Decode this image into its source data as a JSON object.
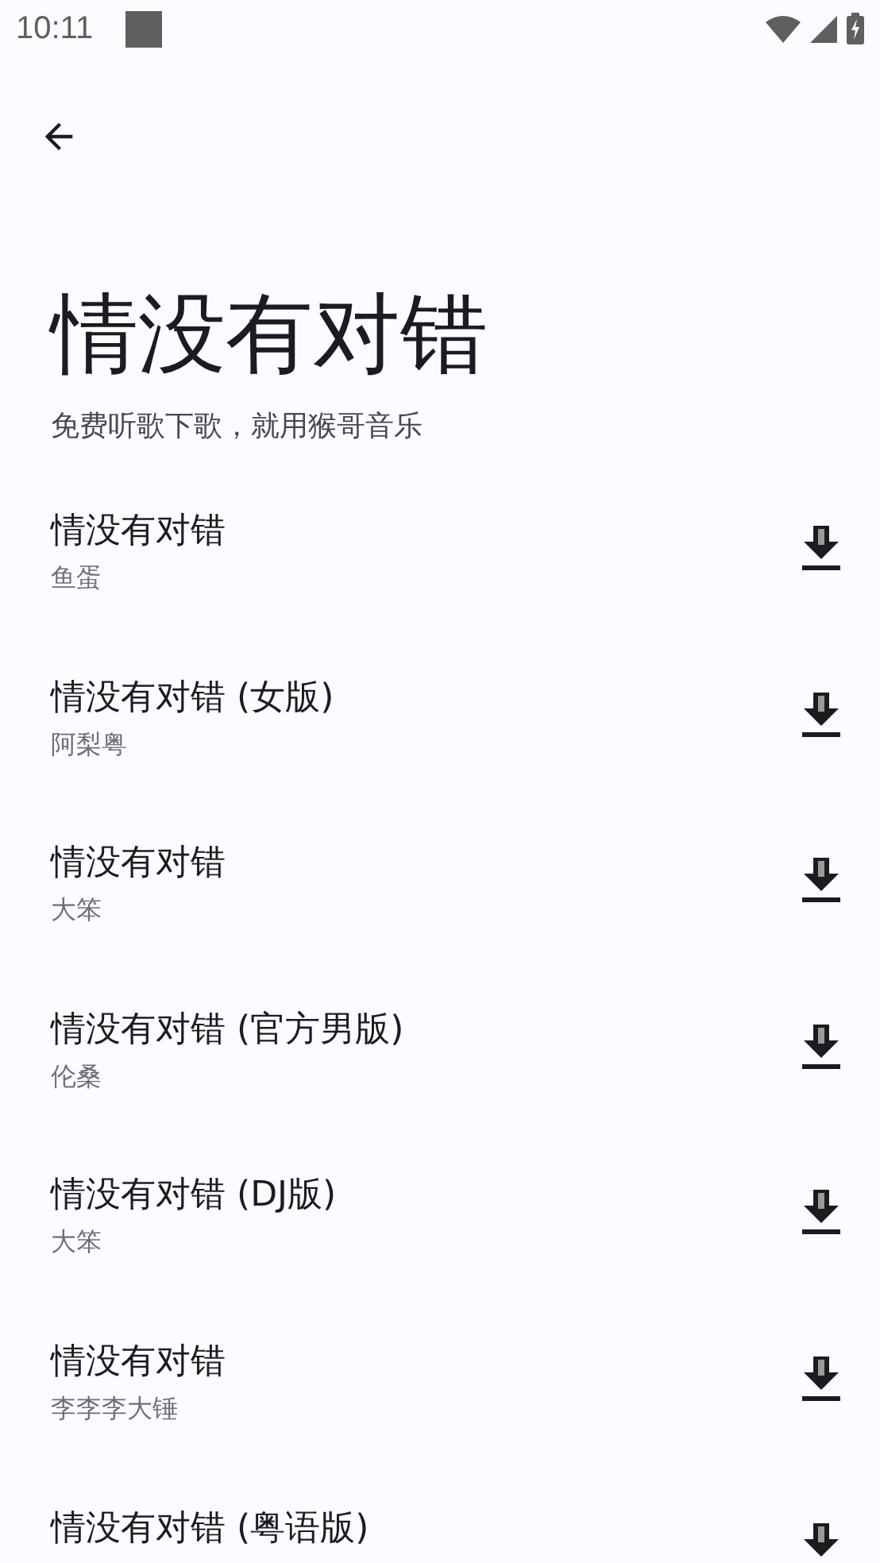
{
  "status_bar": {
    "time": "10:11"
  },
  "header": {
    "title": "情没有对错",
    "subtitle": "免费听歌下歌，就用猴哥音乐"
  },
  "songs": [
    {
      "title": "情没有对错",
      "artist": "鱼蛋"
    },
    {
      "title": "情没有对错 (女版)",
      "artist": "阿梨粤"
    },
    {
      "title": "情没有对错",
      "artist": "大笨"
    },
    {
      "title": "情没有对错 (官方男版)",
      "artist": "伦桑"
    },
    {
      "title": "情没有对错 (DJ版)",
      "artist": "大笨"
    },
    {
      "title": "情没有对错",
      "artist": "李李李大锤"
    },
    {
      "title": "情没有对错 (粤语版)"
    }
  ]
}
